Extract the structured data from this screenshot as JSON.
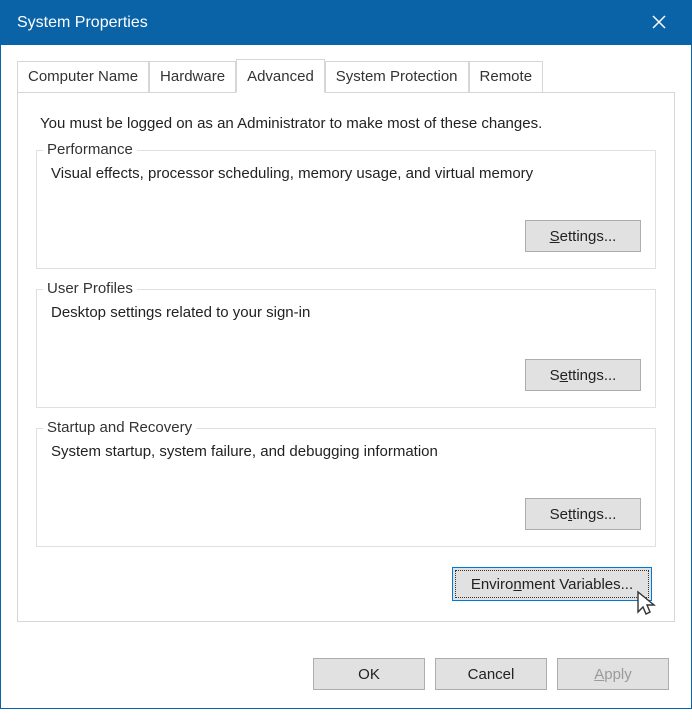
{
  "title": "System Properties",
  "close": "✕",
  "tabs": {
    "computer_name": "Computer Name",
    "hardware": "Hardware",
    "advanced": "Advanced",
    "system_protection": "System Protection",
    "remote": "Remote"
  },
  "intro": "You must be logged on as an Administrator to make most of these changes.",
  "performance": {
    "label": "Performance",
    "desc": "Visual effects, processor scheduling, memory usage, and virtual memory",
    "button_pre": "",
    "button_key": "S",
    "button_post": "ettings..."
  },
  "user_profiles": {
    "label": "User Profiles",
    "desc": "Desktop settings related to your sign-in",
    "button_pre": "S",
    "button_key": "e",
    "button_post": "ttings..."
  },
  "startup": {
    "label": "Startup and Recovery",
    "desc": "System startup, system failure, and debugging information",
    "button_pre": "Se",
    "button_key": "t",
    "button_post": "tings..."
  },
  "env": {
    "button_pre": "Enviro",
    "button_key": "n",
    "button_post": "ment Variables..."
  },
  "buttons": {
    "ok": "OK",
    "cancel": "Cancel",
    "apply_pre": "",
    "apply_key": "A",
    "apply_post": "pply"
  }
}
